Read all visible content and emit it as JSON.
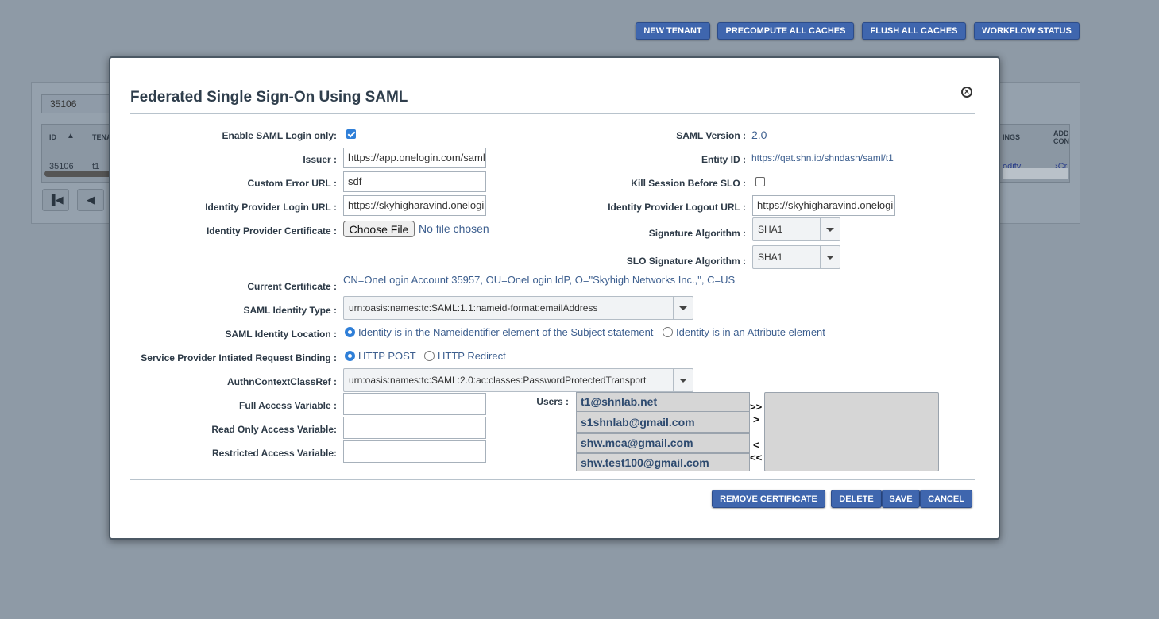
{
  "toolbar": {
    "new_tenant": "NEW TENANT",
    "precompute": "PRECOMPUTE ALL CACHES",
    "flush": "FLUSH ALL CACHES",
    "workflow": "WORKFLOW STATUS"
  },
  "background": {
    "search_value": "35106",
    "col_id": "ID",
    "col_tenant": "TENA",
    "col_settings": "INGS",
    "col_add": "ADD CON",
    "row_id": "35106",
    "row_tenant": "t1",
    "row_modify": "odify",
    "row_create": "›Cr"
  },
  "modal": {
    "title": "Federated Single Sign-On Using SAML",
    "labels": {
      "enable_saml": "Enable SAML Login only:",
      "issuer": "Issuer :",
      "custom_error": "Custom Error URL :",
      "idp_login": "Identity Provider Login URL :",
      "idp_cert": "Identity Provider Certificate :",
      "current_cert": "Current Certificate :",
      "identity_type": "SAML Identity Type :",
      "identity_location": "SAML Identity Location :",
      "sp_binding": "Service Provider Intiated Request Binding :",
      "authn": "AuthnContextClassRef :",
      "full_access": "Full Access Variable :",
      "read_only": "Read Only Access Variable:",
      "restricted": "Restricted Access Variable:",
      "saml_version": "SAML Version :",
      "entity_id": "Entity ID :",
      "kill_session": "Kill Session Before SLO :",
      "idp_logout": "Identity Provider Logout URL :",
      "sig_alg": "Signature Algorithm :",
      "slo_sig_alg": "SLO Signature Algorithm :",
      "users": "Users :"
    },
    "values": {
      "issuer": "https://app.onelogin.com/saml",
      "custom_error": "sdf",
      "idp_login": "https://skyhigharavind.onelogin.com",
      "file_button": "Choose File",
      "file_status": "No file chosen",
      "current_cert": "CN=OneLogin Account 35957, OU=OneLogin IdP, O=\"Skyhigh Networks Inc.,\", C=US",
      "identity_type": "urn:oasis:names:tc:SAML:1.1:nameid-format:emailAddress",
      "loc_option1": "Identity is in the Nameidentifier element of the Subject statement",
      "loc_option2": "Identity is in an Attribute element",
      "binding_post": "HTTP POST",
      "binding_redirect": "HTTP Redirect",
      "authn": "urn:oasis:names:tc:SAML:2.0:ac:classes:PasswordProtectedTransport",
      "full_access": "",
      "read_only": "",
      "restricted": "",
      "saml_version": "2.0",
      "entity_id": "https://qat.shn.io/shndash/saml/t1",
      "idp_logout": "https://skyhigharavind.onelogin.com",
      "sig_alg": "SHA1",
      "slo_sig_alg": "SHA1"
    },
    "users": [
      "t1@shnlab.net",
      "s1shnlab@gmail.com",
      "shw.mca@gmail.com",
      "shw.test100@gmail.com"
    ],
    "arrows": {
      "all_right": ">>",
      "right": ">",
      "left": "<",
      "all_left": "<<"
    },
    "buttons": {
      "remove_cert": "REMOVE CERTIFICATE",
      "delete": "DELETE",
      "save": "SAVE",
      "cancel": "CANCEL"
    },
    "checkbox_enable_saml": true,
    "checkbox_kill_session": false
  }
}
